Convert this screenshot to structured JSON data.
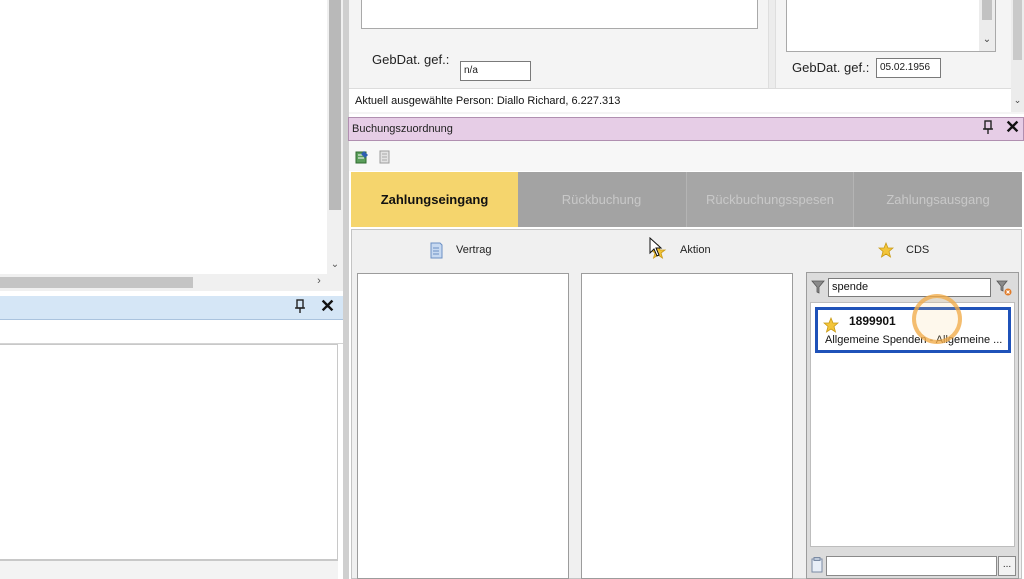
{
  "left_panel": {
    "pin_icon": "pin-icon",
    "close_icon": "close-icon"
  },
  "compare": {
    "gebdat_label": "GebDat. gef.:",
    "gebdat_value_a": "n/a",
    "gebdat_value_b": "05.02.1956"
  },
  "status": {
    "current_person": "Aktuell ausgewählte Person: Diallo Richard, 6.227.313"
  },
  "buchungszuordnung": {
    "title": "Buchungszuordnung",
    "tabs": [
      {
        "label": "Zahlungseingang",
        "active": true
      },
      {
        "label": "Rückbuchung",
        "active": false
      },
      {
        "label": "Rückbuchungsspesen",
        "active": false
      },
      {
        "label": "Zahlungsausgang",
        "active": false
      }
    ],
    "columns": {
      "vertrag": "Vertrag",
      "aktion": "Aktion",
      "cds": "CDS"
    },
    "cds": {
      "search_value": "spende",
      "items": [
        {
          "code": "1899901",
          "description": "Allgemeine Spenden - Allgemeine ..."
        }
      ],
      "more_label": "..."
    }
  },
  "colors": {
    "active_tab": "#f5d56d",
    "panel_header": "#e6cde6",
    "selection_border": "#1f52b9",
    "left_panel_header": "#d5e6f6"
  }
}
